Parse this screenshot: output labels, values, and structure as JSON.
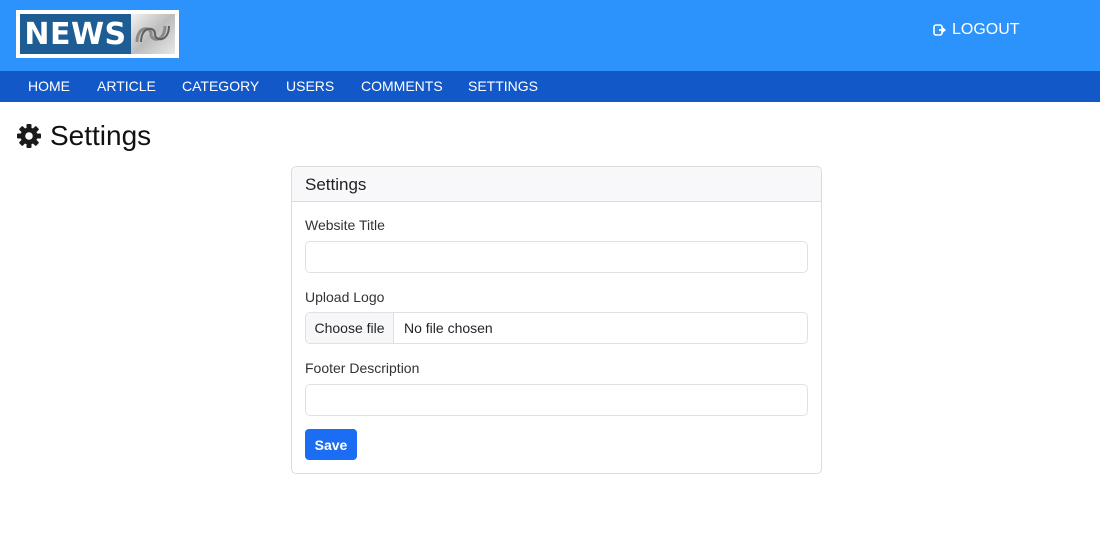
{
  "header": {
    "logo_text": "NEWS",
    "logout_label": "LOGOUT",
    "colors": {
      "topbar": "#2b93fb",
      "navbar": "#1358c8",
      "logo_blue": "#1e5c94"
    },
    "icons": {
      "logout": "logout-icon",
      "logo_mark": "abc-logo-mark"
    }
  },
  "nav": {
    "items": [
      {
        "label": "HOME"
      },
      {
        "label": "ARTICLE"
      },
      {
        "label": "CATEGORY"
      },
      {
        "label": "USERS"
      },
      {
        "label": "COMMENTS"
      },
      {
        "label": "SETTINGS"
      }
    ]
  },
  "page": {
    "title": "Settings",
    "icon": "gear-icon"
  },
  "form": {
    "card_title": "Settings",
    "website_title_label": "Website Title",
    "website_title_value": "",
    "upload_logo_label": "Upload Logo",
    "file_button_label": "Choose file",
    "file_status": "No file chosen",
    "footer_description_label": "Footer Description",
    "footer_description_value": "",
    "save_label": "Save",
    "colors": {
      "save_button": "#1b6ef3"
    }
  }
}
